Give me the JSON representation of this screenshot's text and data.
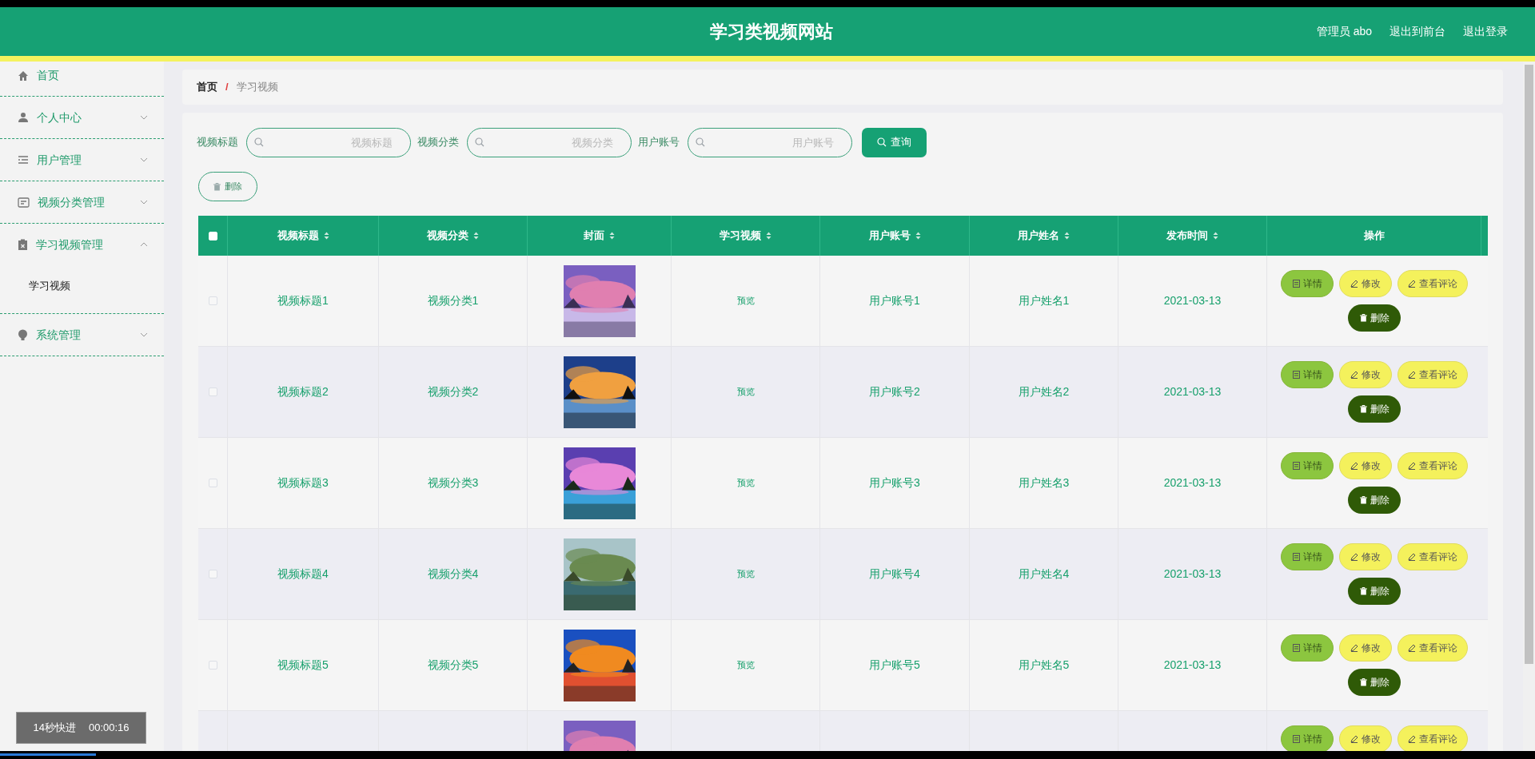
{
  "header": {
    "title": "学习类视频网站",
    "links": [
      "管理员 abo",
      "退出到前台",
      "退出登录"
    ]
  },
  "sidebar": {
    "items": [
      {
        "label": "首页",
        "has_submenu": false
      },
      {
        "label": "个人中心",
        "has_submenu": true,
        "expanded": false
      },
      {
        "label": "用户管理",
        "has_submenu": true,
        "expanded": false
      },
      {
        "label": "视频分类管理",
        "has_submenu": true,
        "expanded": false
      },
      {
        "label": "学习视频管理",
        "has_submenu": true,
        "expanded": true,
        "children": [
          {
            "label": "学习视频"
          }
        ]
      },
      {
        "label": "系统管理",
        "has_submenu": true,
        "expanded": false
      }
    ]
  },
  "breadcrumb": [
    "首页",
    "学习视频"
  ],
  "breadcrumb_separator": "/",
  "search": {
    "fields": [
      {
        "label": "视频标题",
        "placeholder": "视频标题"
      },
      {
        "label": "视频分类",
        "placeholder": "视频分类"
      },
      {
        "label": "用户账号",
        "placeholder": "用户账号"
      }
    ],
    "button": "查询"
  },
  "delete_button": "删除",
  "table": {
    "select_all_checked": false,
    "columns": [
      {
        "label": "视频标题",
        "sortable": true
      },
      {
        "label": "视频分类",
        "sortable": true
      },
      {
        "label": "封面",
        "sortable": true
      },
      {
        "label": "学习视频",
        "sortable": true
      },
      {
        "label": "用户账号",
        "sortable": true
      },
      {
        "label": "用户姓名",
        "sortable": true
      },
      {
        "label": "发布时间",
        "sortable": true
      },
      {
        "label": "操作",
        "sortable": false
      }
    ],
    "rows": [
      {
        "checked": false,
        "title": "视频标题1",
        "category": "视频分类1",
        "cover": {
          "kind": "picture"
        },
        "video": "预览",
        "account": "用户账号1",
        "name": "用户姓名1",
        "time": "2021-03-13",
        "actions": [
          {
            "kind": "detail",
            "label": "详情"
          },
          {
            "kind": "edit",
            "label": "修改"
          },
          {
            "kind": "comment",
            "label": "查看评论"
          },
          {
            "kind": "delete",
            "label": "删除"
          }
        ]
      },
      {
        "checked": false,
        "title": "视频标题2",
        "category": "视频分类2",
        "cover": {
          "kind": "picture"
        },
        "video": "预览",
        "account": "用户账号2",
        "name": "用户姓名2",
        "time": "2021-03-13",
        "actions": [
          {
            "kind": "detail",
            "label": "详情"
          },
          {
            "kind": "edit",
            "label": "修改"
          },
          {
            "kind": "comment",
            "label": "查看评论"
          },
          {
            "kind": "delete",
            "label": "删除"
          }
        ]
      },
      {
        "checked": false,
        "title": "视频标题3",
        "category": "视频分类3",
        "cover": {
          "kind": "picture"
        },
        "video": "预览",
        "account": "用户账号3",
        "name": "用户姓名3",
        "time": "2021-03-13",
        "actions": [
          {
            "kind": "detail",
            "label": "详情"
          },
          {
            "kind": "edit",
            "label": "修改"
          },
          {
            "kind": "comment",
            "label": "查看评论"
          },
          {
            "kind": "delete",
            "label": "删除"
          }
        ]
      },
      {
        "checked": false,
        "title": "视频标题4",
        "category": "视频分类4",
        "cover": {
          "kind": "picture"
        },
        "video": "预览",
        "account": "用户账号4",
        "name": "用户姓名4",
        "time": "2021-03-13",
        "actions": [
          {
            "kind": "detail",
            "label": "详情"
          },
          {
            "kind": "edit",
            "label": "修改"
          },
          {
            "kind": "comment",
            "label": "查看评论"
          },
          {
            "kind": "delete",
            "label": "删除"
          }
        ]
      },
      {
        "checked": false,
        "title": "视频标题5",
        "category": "视频分类5",
        "cover": {
          "kind": "picture"
        },
        "video": "预览",
        "account": "用户账号5",
        "name": "用户姓名5",
        "time": "2021-03-13",
        "actions": [
          {
            "kind": "detail",
            "label": "详情"
          },
          {
            "kind": "edit",
            "label": "修改"
          },
          {
            "kind": "comment",
            "label": "查看评论"
          },
          {
            "kind": "delete",
            "label": "删除"
          }
        ]
      },
      {
        "cover": {
          "kind": "picture"
        },
        "actions": [
          {
            "kind": "detail",
            "label": "详情"
          },
          {
            "kind": "edit",
            "label": "修改"
          },
          {
            "kind": "comment",
            "label": "查看评论"
          }
        ]
      }
    ]
  },
  "recorder": {
    "label": "14秒快进",
    "time": "00:00:16"
  }
}
